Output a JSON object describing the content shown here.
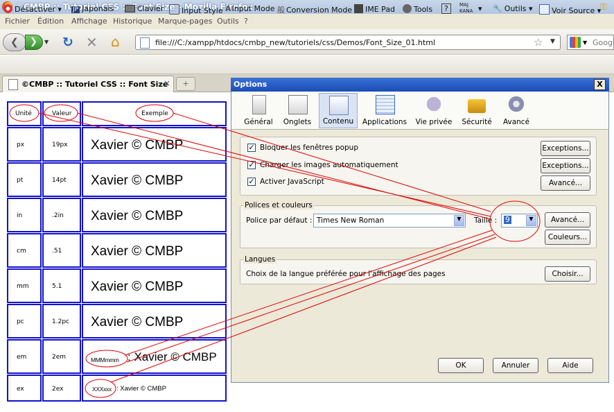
{
  "window": {
    "title": "©CMBP :: Tutoriel CSS :: Font Size - Mozilla Firefox"
  },
  "menu": [
    "Fichier",
    "Édition",
    "Affichage",
    "Historique",
    "Marque-pages",
    "Outils",
    "?"
  ],
  "nav": {
    "url": "file:///C:/xampp/htdocs/cmbp_new/tutoriels/css/Demos/Font_Size_01.html",
    "search_placeholder": "Google"
  },
  "addons": {
    "desactiver": "Désactiver",
    "jp_badge": "JP",
    "japonais": "Japonais",
    "clavier": "Clavier",
    "input_style": "Input Style",
    "input_mode": "Input Mode",
    "conversion_mode": "Conversion Mode",
    "ime_pad": "IME Pad",
    "tools": "Tools",
    "help": "?",
    "maj": "MAJ",
    "kana": "KANA",
    "outils": "Outils",
    "voir_source": "Voir Source"
  },
  "tab": {
    "title": "©CMBP :: Tutoriel CSS :: Font Size",
    "new_tab": "+"
  },
  "table": {
    "headers": {
      "unit": "Unité",
      "value": "Valeur",
      "example": "Exemple"
    },
    "rows": [
      {
        "unit": "px",
        "value": "19px",
        "prefix": "",
        "sample": "Xavier © CMBP"
      },
      {
        "unit": "pt",
        "value": "14pt",
        "prefix": "",
        "sample": "Xavier © CMBP"
      },
      {
        "unit": "in",
        "value": ".2in",
        "prefix": "",
        "sample": "Xavier © CMBP"
      },
      {
        "unit": "cm",
        "value": ".51",
        "prefix": "",
        "sample": "Xavier © CMBP"
      },
      {
        "unit": "mm",
        "value": "5.1",
        "prefix": "",
        "sample": "Xavier © CMBP"
      },
      {
        "unit": "pc",
        "value": "1.2pc",
        "prefix": "",
        "sample": "Xavier © CMBP"
      },
      {
        "unit": "em",
        "value": "2em",
        "prefix": "MMMmmm",
        "sample": ": Xavier © CMBP"
      },
      {
        "unit": "ex",
        "value": "2ex",
        "prefix": "XXXxxx",
        "sample": ": Xavier © CMBP"
      }
    ]
  },
  "dialog": {
    "title": "Options",
    "close": "X",
    "panes": [
      "Général",
      "Onglets",
      "Contenu",
      "Applications",
      "Vie privée",
      "Sécurité",
      "Avancé"
    ],
    "selected_pane": "Contenu",
    "checks": [
      {
        "label": "Bloquer les fenêtres popup",
        "checked": true,
        "button": "Exceptions..."
      },
      {
        "label": "Charger les images automatiquement",
        "checked": true,
        "button": "Exceptions..."
      },
      {
        "label": "Activer JavaScript",
        "checked": true,
        "button": "Avancé..."
      }
    ],
    "fonts": {
      "legend": "Polices et couleurs",
      "default_label": "Police par défaut :",
      "default_font": "Times New Roman",
      "size_label": "Taille :",
      "size_value": "9",
      "advanced": "Avancé...",
      "colors": "Couleurs..."
    },
    "languages": {
      "legend": "Langues",
      "text": "Choix de la langue préférée pour l'affichage des pages",
      "choose": "Choisir..."
    },
    "buttons": {
      "ok": "OK",
      "cancel": "Annuler",
      "help": "Aide"
    }
  },
  "colors": {
    "annotation": "#e00000",
    "table_border": "#1212c8",
    "title_blue": "#1b4cb5"
  }
}
